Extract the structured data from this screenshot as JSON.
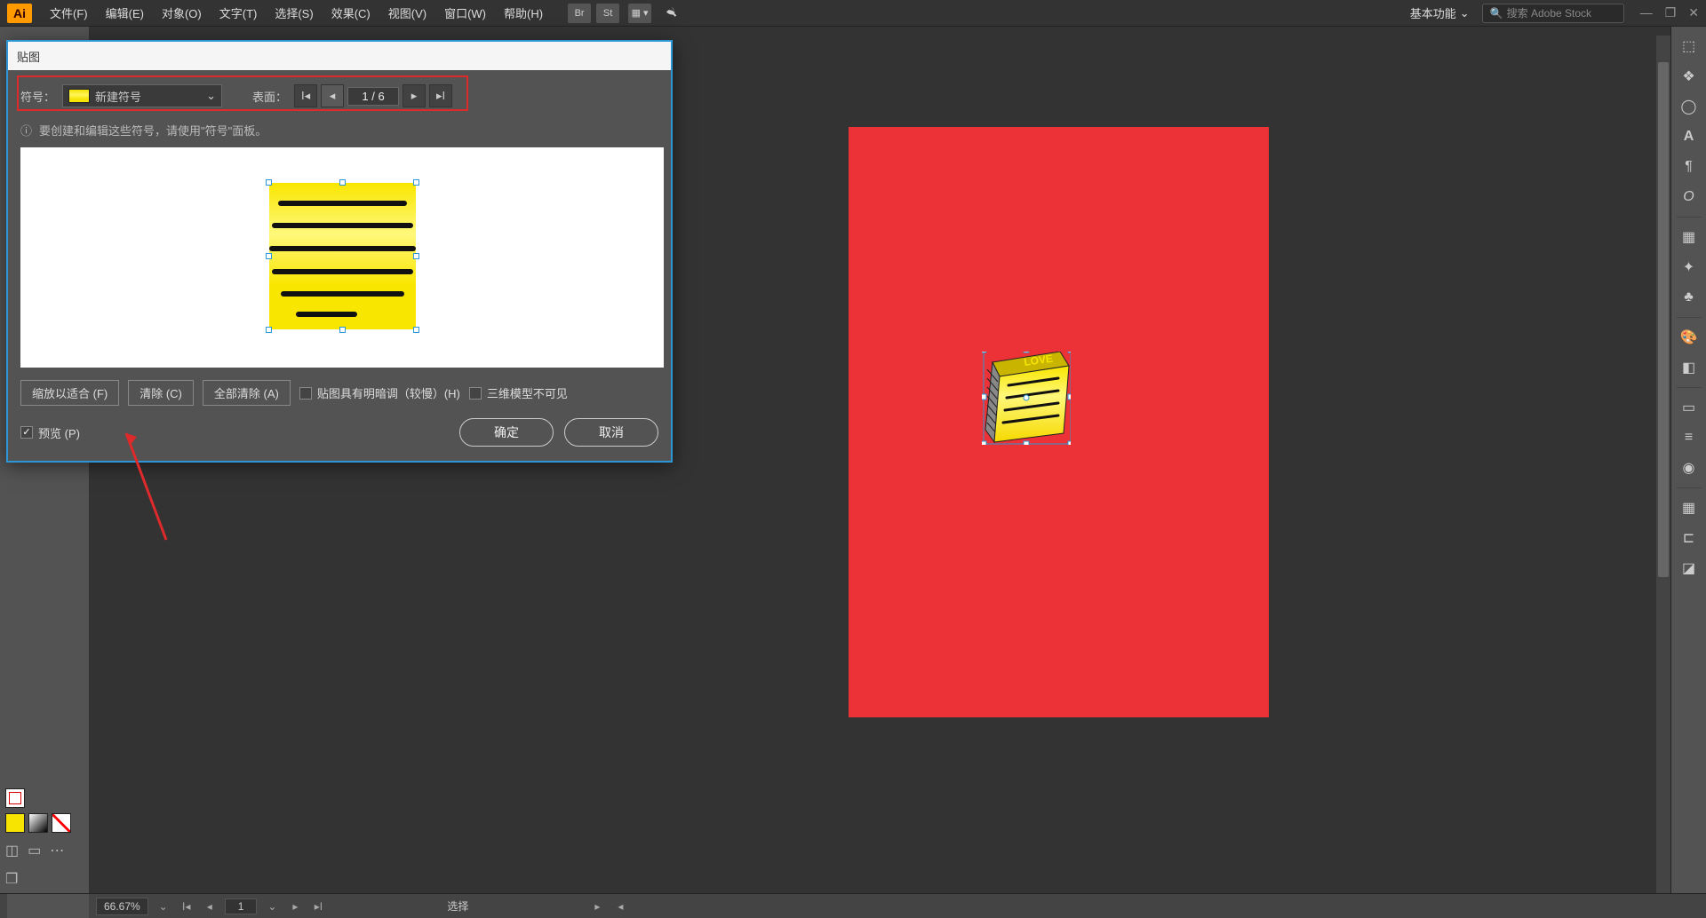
{
  "menubar": {
    "logo": "Ai",
    "items": [
      "文件(F)",
      "编辑(E)",
      "对象(O)",
      "文字(T)",
      "选择(S)",
      "效果(C)",
      "视图(V)",
      "窗口(W)",
      "帮助(H)"
    ],
    "br_icon": "Br",
    "st_icon": "St",
    "workspace": "基本功能",
    "search_placeholder": "搜索 Adobe Stock"
  },
  "dialog": {
    "title": "贴图",
    "symbol_label": "符号：",
    "symbol_name": "新建符号",
    "face_label": "表面：",
    "face_current": "1",
    "face_total": "6",
    "info_text": "要创建和编辑这些符号，请使用\"符号\"面板。",
    "btn_fit": "缩放以适合 (F)",
    "btn_clear": "清除 (C)",
    "btn_clear_all": "全部清除 (A)",
    "chk_shade": "贴图具有明暗调（较慢）(H)",
    "chk_invisible": "三维模型不可见",
    "chk_preview": "预览 (P)",
    "btn_ok": "确定",
    "btn_cancel": "取消"
  },
  "statusbar": {
    "zoom": "66.67%",
    "artboard_num": "1",
    "mode": "选择"
  },
  "canvas": {
    "cube_top_text": "LOVE"
  },
  "right_panel": {
    "icons": [
      "cube-icon",
      "layers-icon",
      "cloud-icon",
      "type-A-icon",
      "paragraph-icon",
      "omega-icon",
      "sep",
      "tile-icon",
      "wand-icon",
      "club-icon",
      "sep",
      "palette-icon",
      "page-icon",
      "sep",
      "rect-icon",
      "menu-lines-icon",
      "blur-circle-icon",
      "sep",
      "grid-icon",
      "align-icon",
      "doc-icon"
    ]
  }
}
